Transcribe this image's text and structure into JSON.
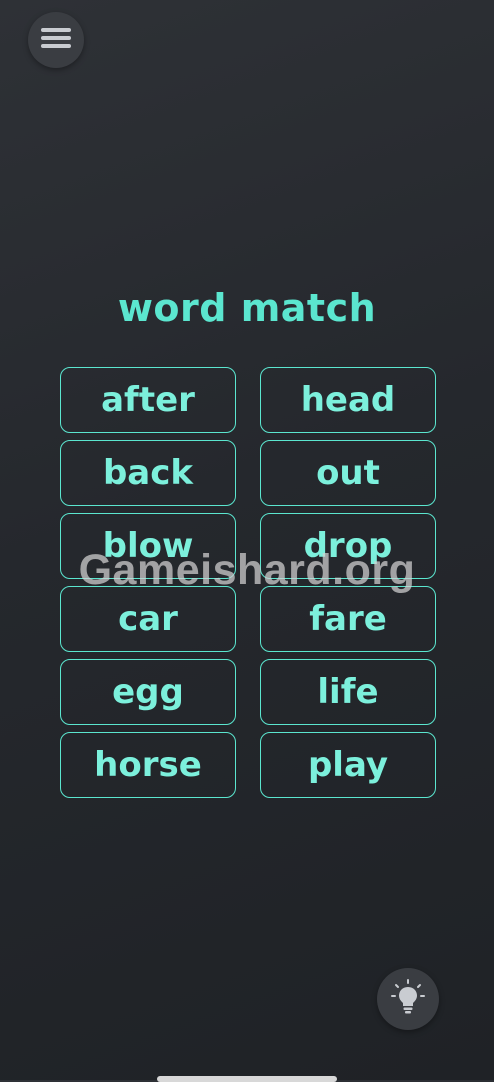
{
  "title": "word match",
  "tiles": [
    {
      "left": "after",
      "right": "head"
    },
    {
      "left": "back",
      "right": "out"
    },
    {
      "left": "blow",
      "right": "drop"
    },
    {
      "left": "car",
      "right": "fare"
    },
    {
      "left": "egg",
      "right": "life"
    },
    {
      "left": "horse",
      "right": "play"
    }
  ],
  "watermark": "Gameishard.org",
  "icons": {
    "menu": "hamburger-menu-icon",
    "hint": "lightbulb-icon"
  },
  "colors": {
    "accent": "#5be6cf",
    "background": "#2a2d32",
    "button": "#3a3d42"
  }
}
